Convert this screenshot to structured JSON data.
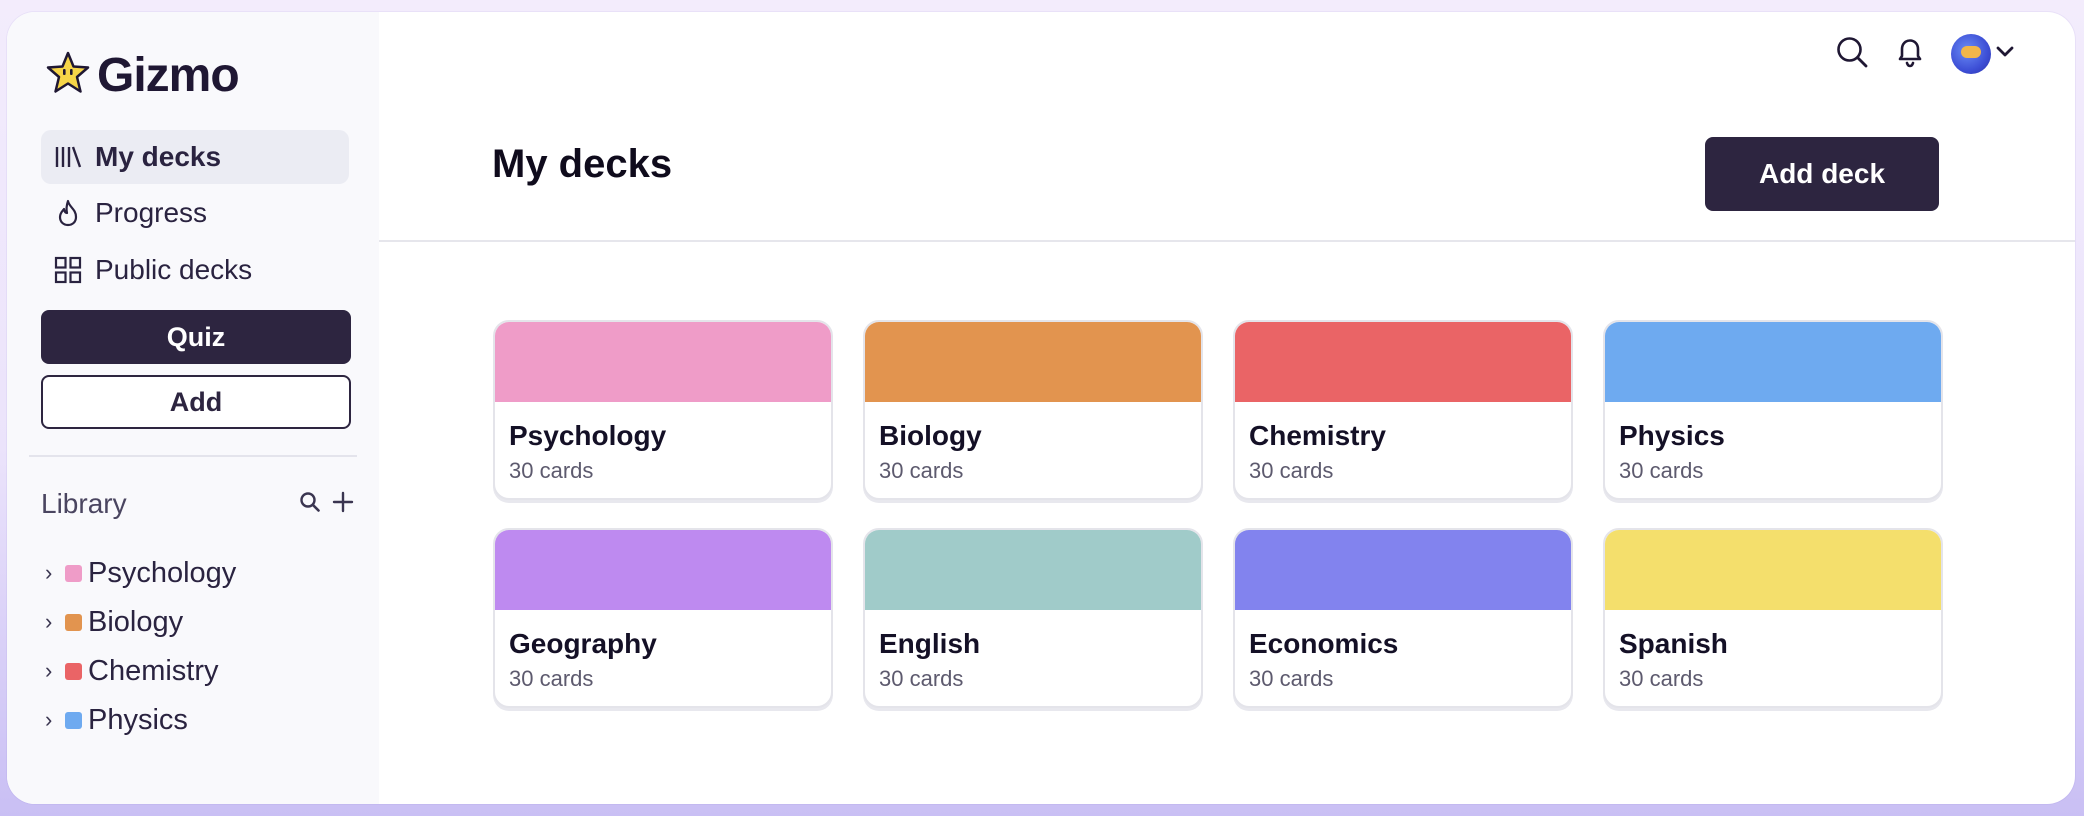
{
  "app": {
    "name": "Gizmo"
  },
  "sidebar": {
    "nav": [
      {
        "label": "My decks",
        "icon": "library-icon",
        "active": true
      },
      {
        "label": "Progress",
        "icon": "flame-icon",
        "active": false
      },
      {
        "label": "Public decks",
        "icon": "grid-icon",
        "active": false
      }
    ],
    "quiz_label": "Quiz",
    "add_label": "Add",
    "library": {
      "label": "Library",
      "items": [
        {
          "label": "Psychology",
          "color": "#ef9cc8"
        },
        {
          "label": "Biology",
          "color": "#e2944f"
        },
        {
          "label": "Chemistry",
          "color": "#ea6466"
        },
        {
          "label": "Physics",
          "color": "#6eaaf0"
        }
      ]
    }
  },
  "header": {
    "title": "My decks",
    "add_deck_label": "Add deck"
  },
  "decks": [
    {
      "name": "Psychology",
      "count": "30 cards",
      "color": "#ef9cc8"
    },
    {
      "name": "Biology",
      "count": "30 cards",
      "color": "#e2944f"
    },
    {
      "name": "Chemistry",
      "count": "30 cards",
      "color": "#ea6466"
    },
    {
      "name": "Physics",
      "count": "30 cards",
      "color": "#6eaaf0"
    },
    {
      "name": "Geography",
      "count": "30 cards",
      "color": "#be8af0"
    },
    {
      "name": "English",
      "count": "30 cards",
      "color": "#a0cbc9"
    },
    {
      "name": "Economics",
      "count": "30 cards",
      "color": "#8283ee"
    },
    {
      "name": "Spanish",
      "count": "30 cards",
      "color": "#f4df6c"
    }
  ],
  "theme": {
    "primary": "#2d2540",
    "active_nav_bg": "#ebecf3"
  }
}
